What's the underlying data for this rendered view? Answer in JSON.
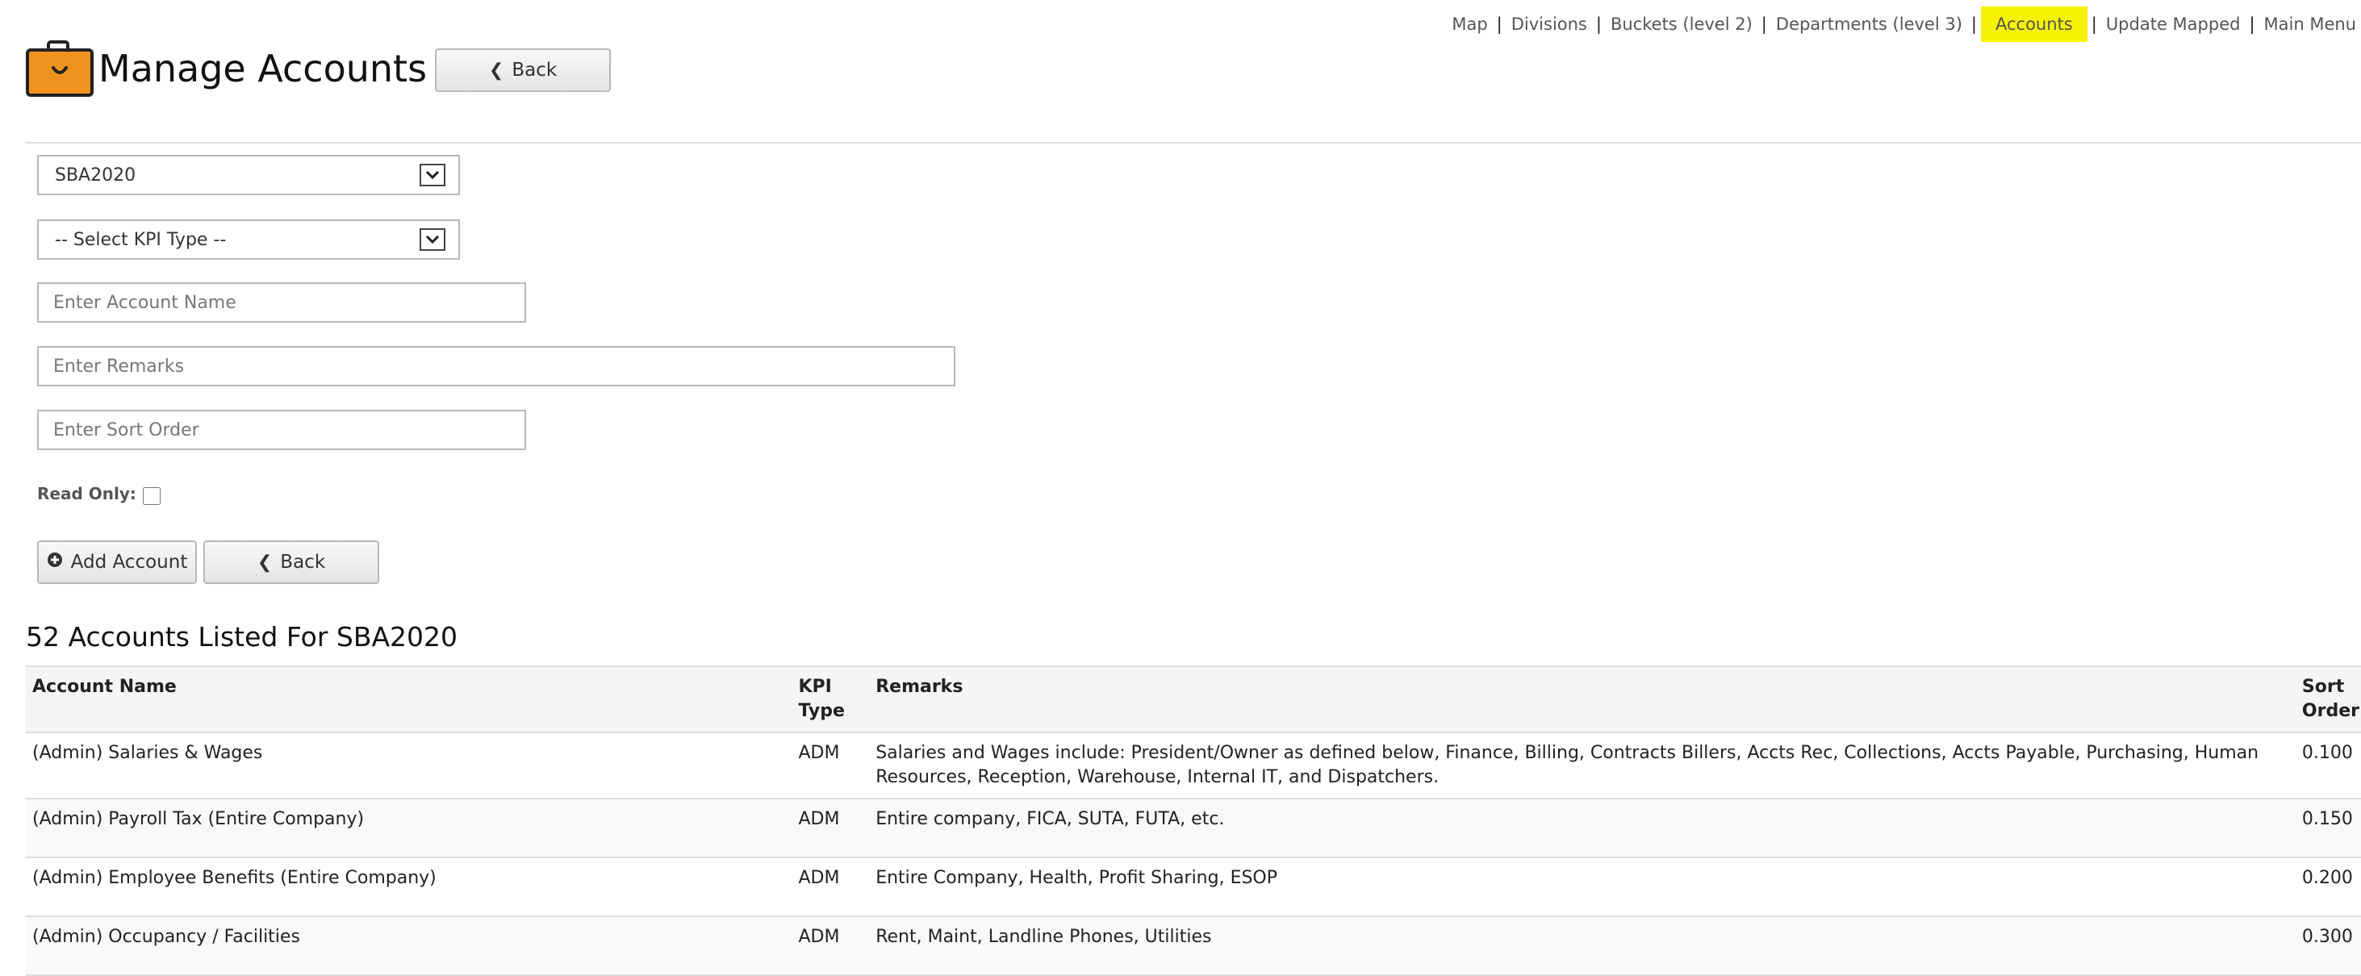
{
  "nav": {
    "items": [
      {
        "label": "Map",
        "active": false
      },
      {
        "label": "Divisions",
        "active": false
      },
      {
        "label": "Buckets (level 2)",
        "active": false
      },
      {
        "label": "Departments (level 3)",
        "active": false
      },
      {
        "label": "Accounts",
        "active": true
      },
      {
        "label": "Update Mapped",
        "active": false
      },
      {
        "label": "Main Menu",
        "active": false
      }
    ],
    "separator": "|",
    "active_highlight": "#f7f300"
  },
  "header": {
    "icon": "briefcase-icon",
    "icon_color": "#f0931e",
    "title": "Manage Accounts",
    "back_label": "Back"
  },
  "form": {
    "map_select": {
      "value": "SBA2020"
    },
    "kpi_select": {
      "value": "-- Select KPI Type --"
    },
    "account_name": {
      "placeholder": "Enter Account Name",
      "value": ""
    },
    "remarks": {
      "placeholder": "Enter Remarks",
      "value": ""
    },
    "sort_order": {
      "placeholder": "Enter Sort Order",
      "value": ""
    },
    "read_only_label": "Read Only:",
    "read_only_checked": false,
    "add_label": "Add Account",
    "back_label": "Back"
  },
  "list": {
    "heading": "52 Accounts Listed For SBA2020",
    "columns": [
      "Account Name",
      "KPI Type",
      "Remarks",
      "Sort Order"
    ],
    "rows": [
      {
        "name": "(Admin) Salaries & Wages",
        "kpi": "ADM",
        "remarks": "Salaries and Wages include: President/Owner as defined below, Finance, Billing, Contracts Billers, Accts Rec, Collections, Accts Payable, Purchasing, Human Resources, Reception, Warehouse, Internal IT, and Dispatchers.",
        "sort": "0.100"
      },
      {
        "name": "(Admin) Payroll Tax (Entire Company)",
        "kpi": "ADM",
        "remarks": "Entire company, FICA, SUTA, FUTA, etc.",
        "sort": "0.150"
      },
      {
        "name": "(Admin) Employee Benefits (Entire Company)",
        "kpi": "ADM",
        "remarks": "Entire Company, Health, Profit Sharing, ESOP",
        "sort": "0.200"
      },
      {
        "name": "(Admin) Occupancy / Facilities",
        "kpi": "ADM",
        "remarks": "Rent, Maint, Landline Phones, Utilities",
        "sort": "0.300"
      }
    ]
  }
}
